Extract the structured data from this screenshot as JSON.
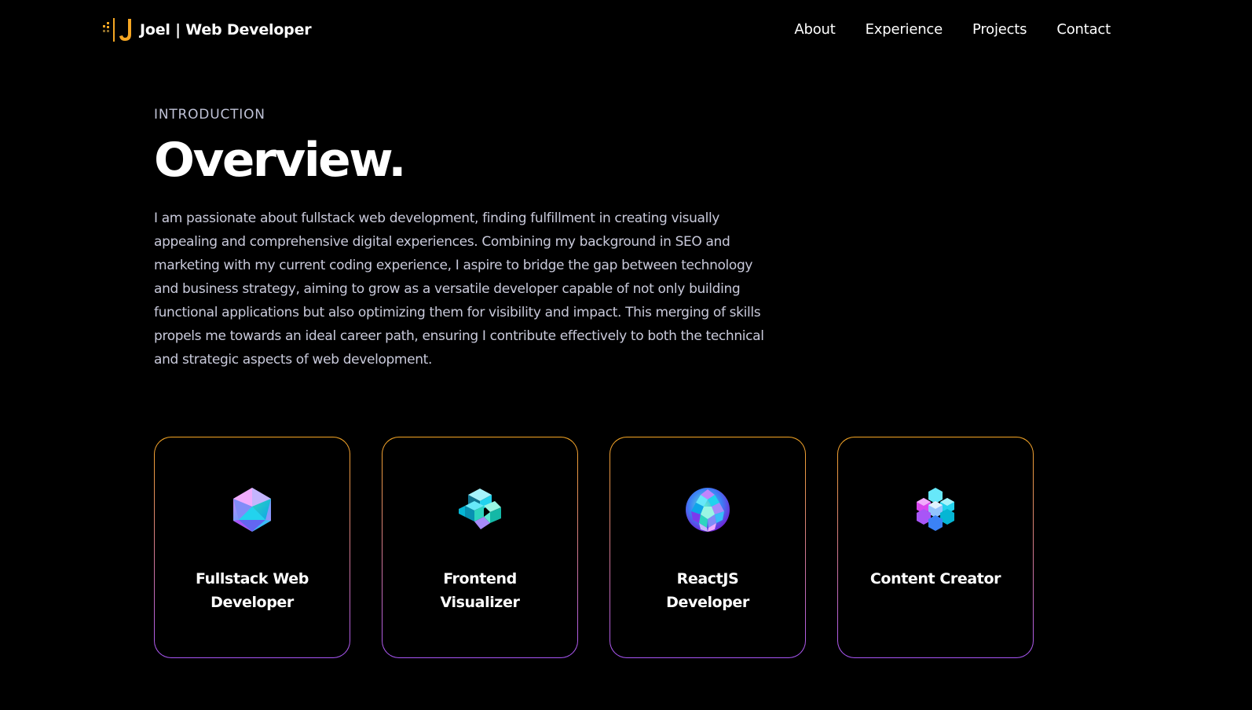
{
  "nav": {
    "brand": {
      "logo_icon": "js-bracket-logo-icon",
      "name": "Joel | Web Developer"
    },
    "links": [
      {
        "label": "About"
      },
      {
        "label": "Experience"
      },
      {
        "label": "Projects"
      },
      {
        "label": "Contact"
      }
    ]
  },
  "overview": {
    "eyebrow": "INTRODUCTION",
    "title": "Overview.",
    "description": "I am passionate about fullstack web development, finding fulfillment in creating visually appealing and comprehensive digital experiences. Combining my background in SEO and marketing with my current coding experience, I aspire to bridge the gap between technology and business strategy, aiming to grow as a versatile developer capable of not only building functional applications but also optimizing them for visibility and impact. This merging of skills propels me towards an ideal career path, ensuring I contribute effectively to both the technical and strategic aspects of web development."
  },
  "services": [
    {
      "title": "Fullstack Web Developer",
      "icon": "iridescent-icosahedron-icon"
    },
    {
      "title": "Frontend Visualizer",
      "icon": "iridescent-cube-cluster-icon"
    },
    {
      "title": "ReactJS Developer",
      "icon": "iridescent-geodesic-sphere-icon"
    },
    {
      "title": "Content Creator",
      "icon": "iridescent-hexagon-cluster-icon"
    }
  ],
  "colors": {
    "background": "#000000",
    "accent": "#f5a623",
    "card_border_top": "#f5a623",
    "card_border_bottom": "#a855f7",
    "text": "#ffffff",
    "muted_text": "#c9cadb"
  }
}
